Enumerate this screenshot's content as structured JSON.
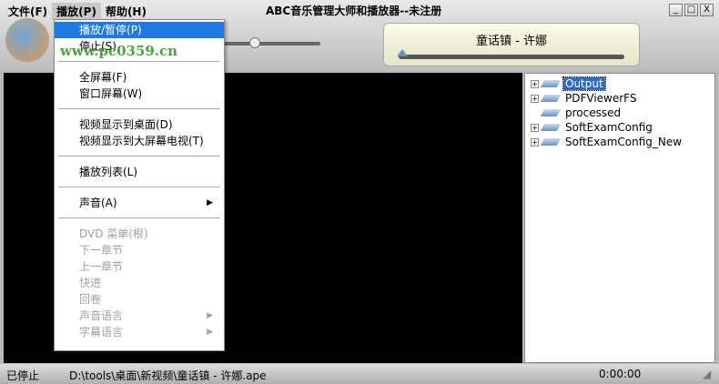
{
  "window": {
    "title": "ABC音乐管理大师和播放器--未注册",
    "min": "_",
    "max": "□",
    "close": "X"
  },
  "menubar": [
    "文件(F)",
    "播放(P)",
    "帮助(H)"
  ],
  "now_playing": {
    "song": "童话镇 - 许娜",
    "progress_percent": 0
  },
  "menu": {
    "items": [
      {
        "label": "播放/暂停(P)",
        "state": "highlighted"
      },
      {
        "label": "停止(S)"
      },
      {
        "sep": true
      },
      {
        "label": "全屏幕(F)"
      },
      {
        "label": "窗口屏幕(W)"
      },
      {
        "sep": true
      },
      {
        "label": "视频显示到桌面(D)"
      },
      {
        "label": "视频显示到大屏幕电视(T)"
      },
      {
        "sep": true
      },
      {
        "label": "播放列表(L)"
      },
      {
        "sep": true
      },
      {
        "label": "声音(A)",
        "submenu": true
      },
      {
        "sep": true
      },
      {
        "label": "DVD 菜单(根)",
        "disabled": true
      },
      {
        "label": "下一章节",
        "disabled": true
      },
      {
        "label": "上一章节",
        "disabled": true
      },
      {
        "label": "快进",
        "disabled": true
      },
      {
        "label": "回卷",
        "disabled": true
      },
      {
        "label": "声音语言",
        "disabled": true,
        "submenu": true
      },
      {
        "label": "字幕语言",
        "disabled": true,
        "submenu": true
      }
    ]
  },
  "tree": [
    {
      "label": "Output",
      "expandable": true,
      "selected": true
    },
    {
      "label": "PDFViewerFS",
      "expandable": true
    },
    {
      "label": "processed",
      "expandable": false
    },
    {
      "label": "SoftExamConfig",
      "expandable": true
    },
    {
      "label": "SoftExamConfig_New",
      "expandable": true
    }
  ],
  "status": {
    "state": "已停止",
    "path": "D:\\tools\\桌面\\新视频\\童话镇 - 许娜.ape",
    "time": "0:00:00"
  },
  "watermark": "www.pc0359.cn"
}
